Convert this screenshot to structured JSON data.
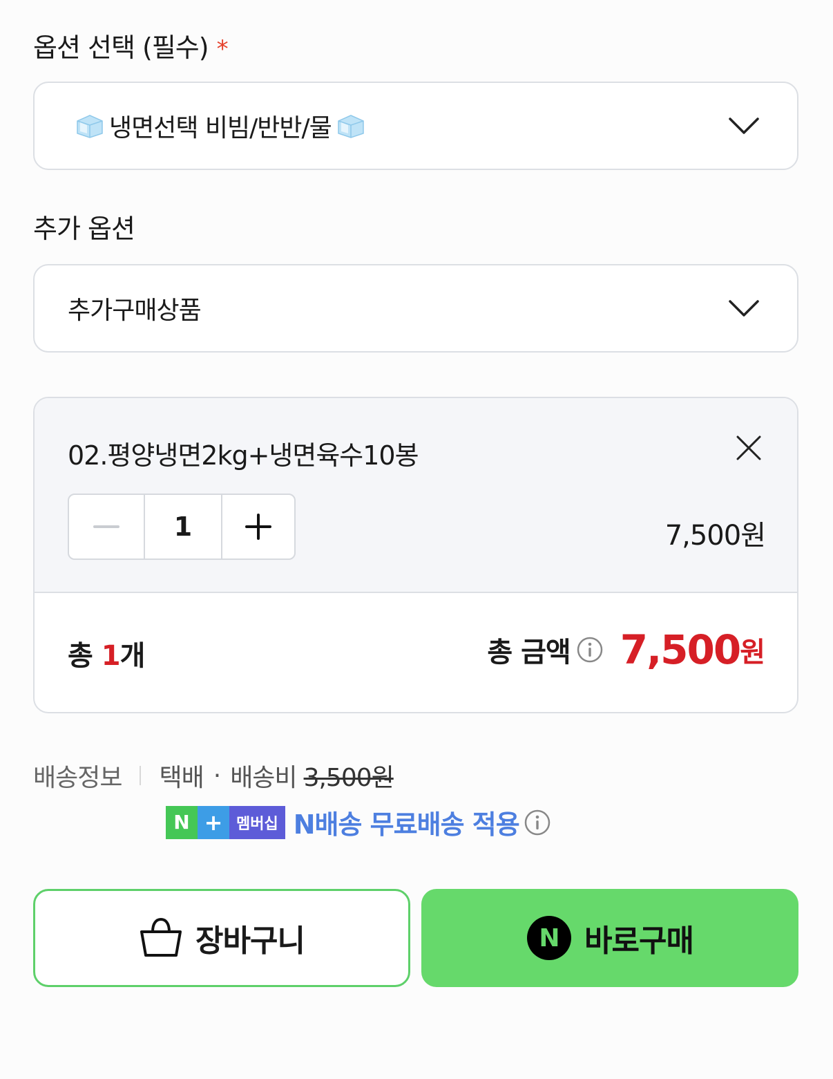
{
  "options": {
    "required_title": "옵션 선택 (필수)",
    "required_star": "*",
    "required_selected": "냉면선택 비빔/반반/물",
    "additional_title": "추가 옵션",
    "additional_selected": "추가구매상품"
  },
  "selected_item": {
    "name": "02.평양냉면2kg+냉면육수10봉",
    "quantity": "1",
    "price": "7,500원"
  },
  "summary": {
    "count_prefix": "총 ",
    "count_value": "1",
    "count_suffix": "개",
    "amount_label": "총 금액",
    "amount_value": "7,500",
    "amount_unit": "원"
  },
  "shipping": {
    "label": "배송정보",
    "method": "택배",
    "separator": "·",
    "fee_label": "배송비",
    "fee_original": "3,500원",
    "badge_n": "N",
    "badge_plus": "+",
    "badge_membership": "멤버십",
    "promo_text": "N배송 무료배송 적용"
  },
  "buttons": {
    "cart": "장바구니",
    "buy": "바로구매",
    "buy_logo": "N"
  },
  "colors": {
    "accent_red": "#d61f26",
    "buy_green": "#66d96b",
    "promo_blue": "#4d7fe0"
  }
}
